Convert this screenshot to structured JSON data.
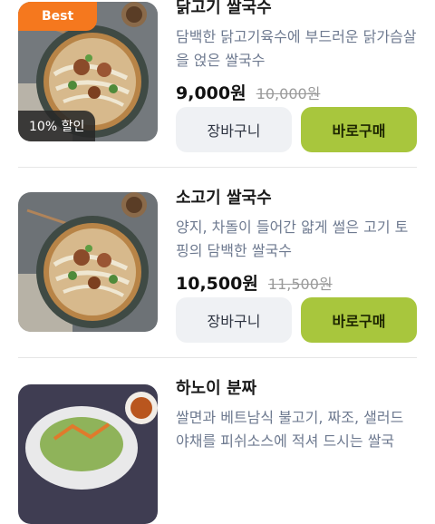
{
  "items": [
    {
      "name": "닭고기 쌀국수",
      "description": "담백한 닭고기육수에 부드러운 닭가슴살을 얹은 쌀국수",
      "price": "9,000원",
      "original_price": "10,000원",
      "badge_top": "Best",
      "badge_bottom": "10% 할인",
      "image": "pho-bowl",
      "cart_label": "장바구니",
      "buy_label": "바로구매"
    },
    {
      "name": "소고기 쌀국수",
      "description": "양지, 차돌이 들어간 얇게 썰은 고기 토핑의 담백한 쌀국수",
      "price": "10,500원",
      "original_price": "11,500원",
      "image": "pho-bowl",
      "cart_label": "장바구니",
      "buy_label": "바로구매"
    },
    {
      "name": "하노이 분짜",
      "description": "쌀면과 베트남식 불고기, 짜조, 샐러드 야채를 피쉬소스에 적셔 드시는 쌀국",
      "image": "bun-cha-plate"
    }
  ],
  "colors": {
    "buy_button": "#a8c63d",
    "cart_button": "#eff1f4",
    "best_badge": "#f5781e",
    "description": "#6e7a90"
  }
}
